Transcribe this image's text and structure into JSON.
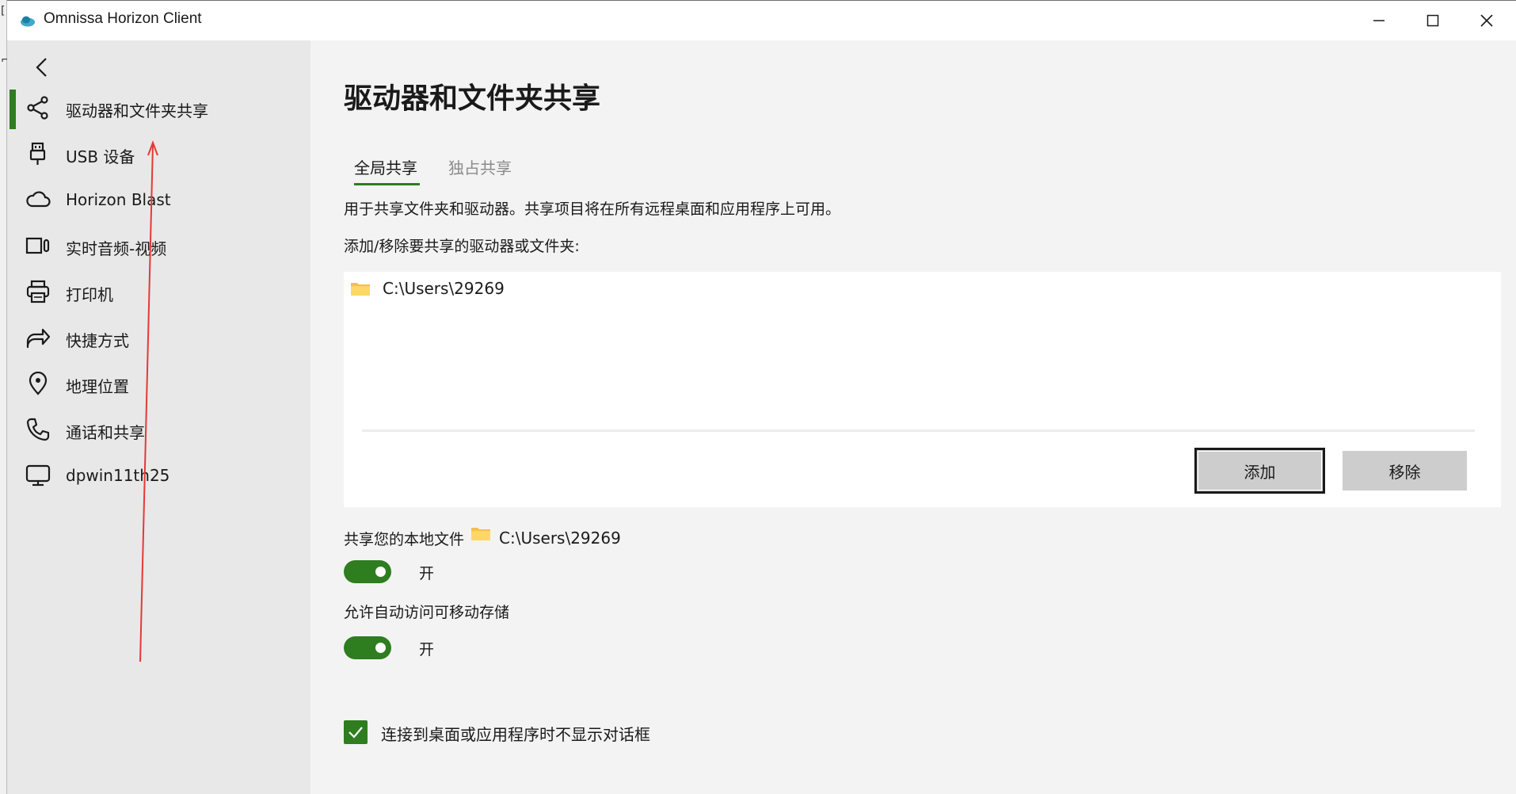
{
  "window": {
    "title": "Omnissa Horizon Client"
  },
  "sidebar": {
    "back_icon": "chevron-left-icon",
    "items": [
      {
        "label": "驱动器和文件夹共享",
        "icon": "share-icon",
        "selected": true
      },
      {
        "label": "USB 设备",
        "icon": "usb-icon",
        "selected": false
      },
      {
        "label": "Horizon Blast",
        "icon": "cloud-icon",
        "selected": false
      },
      {
        "label": "实时音频-视频",
        "icon": "video-camera-icon",
        "selected": false
      },
      {
        "label": "打印机",
        "icon": "printer-icon",
        "selected": false
      },
      {
        "label": "快捷方式",
        "icon": "shortcut-arrow-icon",
        "selected": false
      },
      {
        "label": "地理位置",
        "icon": "location-pin-icon",
        "selected": false
      },
      {
        "label": "通话和共享",
        "icon": "phone-icon",
        "selected": false
      },
      {
        "label": "dpwin11th25",
        "icon": "monitor-icon",
        "selected": false
      }
    ]
  },
  "main": {
    "title": "驱动器和文件夹共享",
    "tabs": [
      {
        "label": "全局共享",
        "active": true
      },
      {
        "label": "独占共享",
        "active": false
      }
    ],
    "description": "用于共享文件夹和驱动器。共享项目将在所有远程桌面和应用程序上可用。",
    "list_label": "添加/移除要共享的驱动器或文件夹:",
    "shared_items": [
      {
        "path": "C:\\Users\\29269",
        "icon": "folder-icon"
      }
    ],
    "add_button": "添加",
    "remove_button": "移除",
    "share_local_label": "共享您的本地文件",
    "share_local_path": "C:\\Users\\29269",
    "share_local_toggle": {
      "on": true,
      "state_label": "开"
    },
    "removable_label": "允许自动访问可移动存储",
    "removable_toggle": {
      "on": true,
      "state_label": "开"
    },
    "no_dialog_checkbox": {
      "checked": true,
      "label": "连接到桌面或应用程序时不显示对话框"
    }
  },
  "colors": {
    "accent": "#2e7d1f",
    "sidebar_bg": "#e8e8e8",
    "main_bg": "#f3f3f3",
    "annotation": "#e53935"
  }
}
